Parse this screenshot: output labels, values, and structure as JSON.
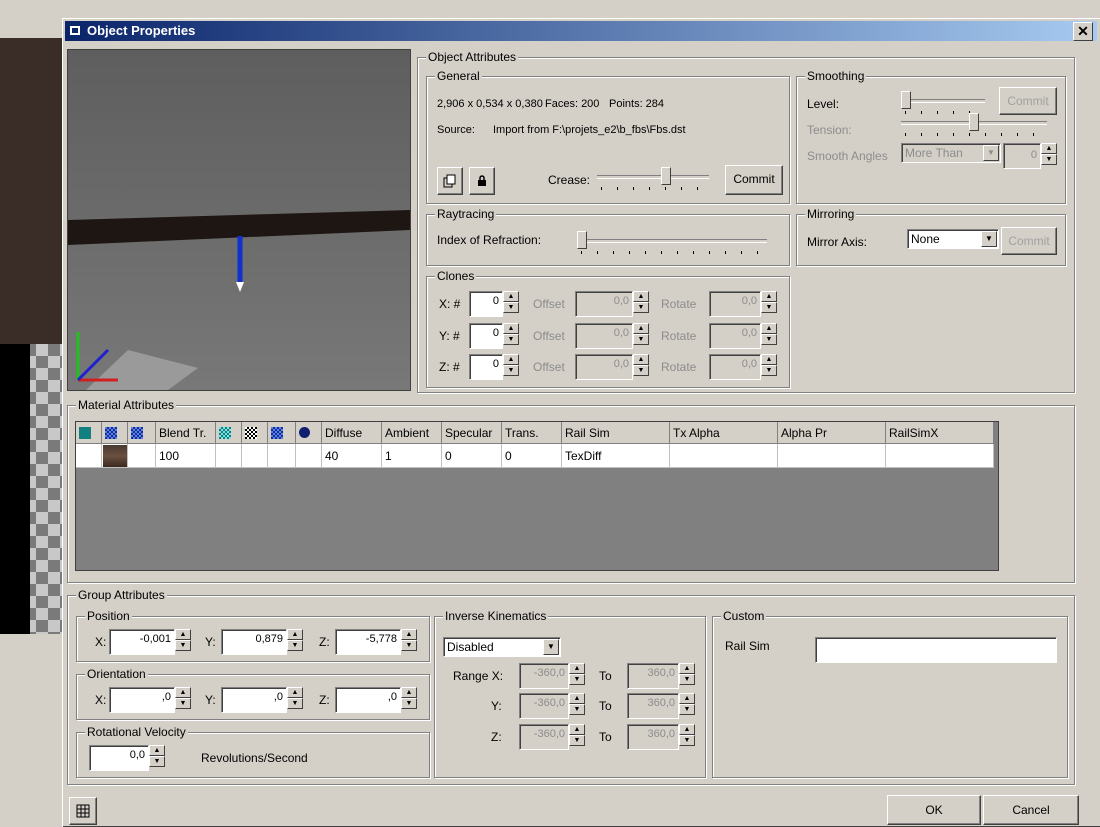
{
  "dialog": {
    "title": "Object Properties",
    "close_glyph": "✕"
  },
  "object_attributes": {
    "label": "Object Attributes",
    "general": {
      "label": "General",
      "dimensions": "2,906 x 0,534 x 0,380",
      "faces": "Faces: 200",
      "points": "Points: 284",
      "source_label": "Source:",
      "source_value": "Import from F:\\projets_e2\\b_fbs\\Fbs.dst",
      "crease_label": "Crease:",
      "commit_label": "Commit"
    },
    "smoothing": {
      "label": "Smoothing",
      "level_label": "Level:",
      "commit_label": "Commit",
      "tension_label": "Tension:",
      "smooth_angles_label": "Smooth Angles",
      "smooth_angles_option": "More Than",
      "smooth_angles_value": "0"
    },
    "raytracing": {
      "label": "Raytracing",
      "ior_label": "Index of Refraction:"
    },
    "mirroring": {
      "label": "Mirroring",
      "axis_label": "Mirror Axis:",
      "axis_value": "None",
      "commit_label": "Commit"
    },
    "clones": {
      "label": "Clones",
      "offset_label": "Offset",
      "rotate_label": "Rotate",
      "rows": [
        {
          "axis": "X: #",
          "count": "0",
          "offset": "0,0",
          "rotate": "0,0"
        },
        {
          "axis": "Y: #",
          "count": "0",
          "offset": "0,0",
          "rotate": "0,0"
        },
        {
          "axis": "Z: #",
          "count": "0",
          "offset": "0,0",
          "rotate": "0,0"
        }
      ]
    }
  },
  "material_attributes": {
    "label": "Material Attributes",
    "columns": [
      "",
      "",
      "",
      "Blend Tr.",
      "",
      "",
      "",
      "",
      "Diffuse",
      "Ambient",
      "Specular",
      "Trans.",
      "Rail Sim",
      "Tx Alpha",
      "Alpha Pr",
      "RailSimX"
    ],
    "row": [
      "",
      "",
      "",
      "100",
      "",
      "",
      "",
      "",
      "40",
      "1",
      "0",
      "0",
      "TexDiff",
      "",
      "",
      ""
    ]
  },
  "group_attributes": {
    "label": "Group Attributes",
    "position": {
      "label": "Position",
      "x_label": "X:",
      "x": "-0,001",
      "y_label": "Y:",
      "y": "0,879",
      "z_label": "Z:",
      "z": "-5,778"
    },
    "orientation": {
      "label": "Orientation",
      "x_label": "X:",
      "x": ",0",
      "y_label": "Y:",
      "y": ",0",
      "z_label": "Z:",
      "z": ",0"
    },
    "rotational_velocity": {
      "label": "Rotational Velocity",
      "value": "0,0",
      "unit": "Revolutions/Second"
    },
    "inverse_kinematics": {
      "label": "Inverse Kinematics",
      "mode": "Disabled",
      "to_label": "To",
      "rows": [
        {
          "axis": "Range X:",
          "from": "-360,0",
          "to": "360,0"
        },
        {
          "axis": "Y:",
          "from": "-360,0",
          "to": "360,0"
        },
        {
          "axis": "Z:",
          "from": "-360,0",
          "to": "360,0"
        }
      ]
    },
    "custom": {
      "label": "Custom",
      "rail_sim_label": "Rail Sim",
      "rail_sim_value": ""
    }
  },
  "footer": {
    "ok_label": "OK",
    "cancel_label": "Cancel"
  },
  "colors": {
    "title_start": "#0a246a",
    "title_end": "#a6caf0",
    "face": "#d4d0c8"
  }
}
